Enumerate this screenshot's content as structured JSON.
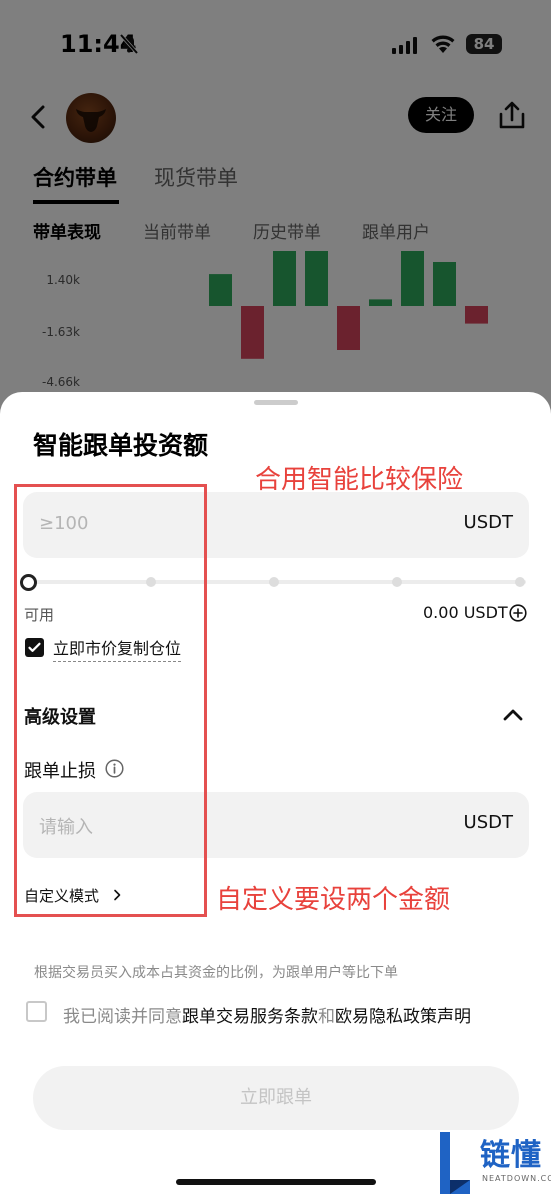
{
  "status_bar": {
    "time": "11:44",
    "battery": "84"
  },
  "header": {
    "follow_label": "关注"
  },
  "main_tabs": [
    {
      "label": "合约带单"
    },
    {
      "label": "现货带单"
    }
  ],
  "sub_tabs": [
    {
      "label": "带单表现"
    },
    {
      "label": "当前带单"
    },
    {
      "label": "历史带单"
    },
    {
      "label": "跟单用户"
    }
  ],
  "chart_data": {
    "type": "bar",
    "yticks": [
      "1.40k",
      "-1.63k",
      "-4.66k"
    ],
    "values": [
      1.45,
      -2.4,
      2.5,
      2.5,
      -2.0,
      0.3,
      2.5,
      2.0,
      -0.8
    ],
    "colors": {
      "positive": "#2eaa5c",
      "negative": "#d6455d"
    }
  },
  "sheet": {
    "title": "智能跟单投资额",
    "amount_input": {
      "placeholder": "≥100",
      "unit": "USDT"
    },
    "available_label": "可用",
    "available_value": "0.00 USDT",
    "copy_position_label": "立即市价复制仓位",
    "copy_position_checked": true,
    "advanced_title": "高级设置",
    "stop_loss_label": "跟单止损",
    "stop_loss_input": {
      "placeholder": "请输入",
      "unit": "USDT"
    },
    "custom_mode_label": "自定义模式",
    "ratio_note": "根据交易员买入成本占其资金的比例，为跟单用户等比下单",
    "agree_prefix": "我已阅读并同意",
    "agree_link1": "跟单交易服务条款",
    "agree_and": "和",
    "agree_link2": "欧易隐私政策声明",
    "submit_label": "立即跟单"
  },
  "annotations": {
    "note1": "合用智能比较保险",
    "note2": "自定义要设两个金额",
    "color": "#e8423c"
  },
  "watermark": {
    "text": "链懂",
    "sub": "NEATDOWN.COM"
  }
}
